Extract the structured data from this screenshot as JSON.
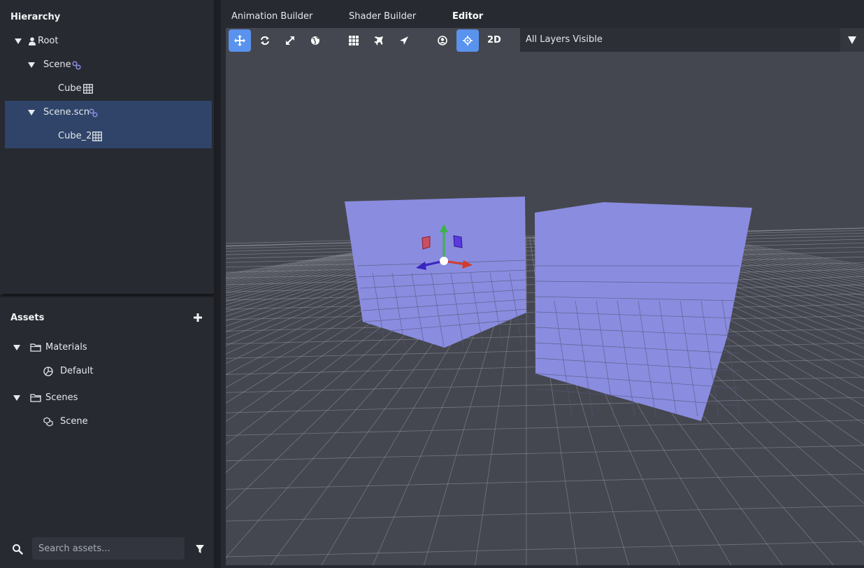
{
  "hierarchy": {
    "title": "Hierarchy",
    "items": [
      {
        "label": "Root",
        "icon": "user-icon"
      },
      {
        "label": "Scene",
        "icon": "link-icon"
      },
      {
        "label": "Cube",
        "icon": "grid-icon"
      },
      {
        "label": "Scene.scn",
        "icon": "link-icon",
        "selected": true
      },
      {
        "label": "Cube_2",
        "icon": "grid-icon",
        "selected": true
      }
    ]
  },
  "assets": {
    "title": "Assets",
    "items": [
      {
        "label": "Materials",
        "icon": "folder-icon"
      },
      {
        "label": "Default",
        "icon": "material-icon"
      },
      {
        "label": "Scenes",
        "icon": "folder-icon"
      },
      {
        "label": "Scene",
        "icon": "scene-icon"
      }
    ],
    "search": {
      "placeholder": "Search assets..."
    }
  },
  "tabs": [
    {
      "label": "Animation Builder"
    },
    {
      "label": "Shader Builder"
    },
    {
      "label": "Editor",
      "active": true
    }
  ],
  "toolbar": {
    "mode_2d_label": "2D",
    "layers_label": "All Layers Visible"
  },
  "colors": {
    "accent": "#5a93ee",
    "selection": "#2f4468",
    "cube": "#8a8ce0",
    "viewport_bg": "#454750",
    "axis_x": "#d23c2c",
    "axis_y": "#3fb24a",
    "axis_z": "#3a24c0"
  }
}
